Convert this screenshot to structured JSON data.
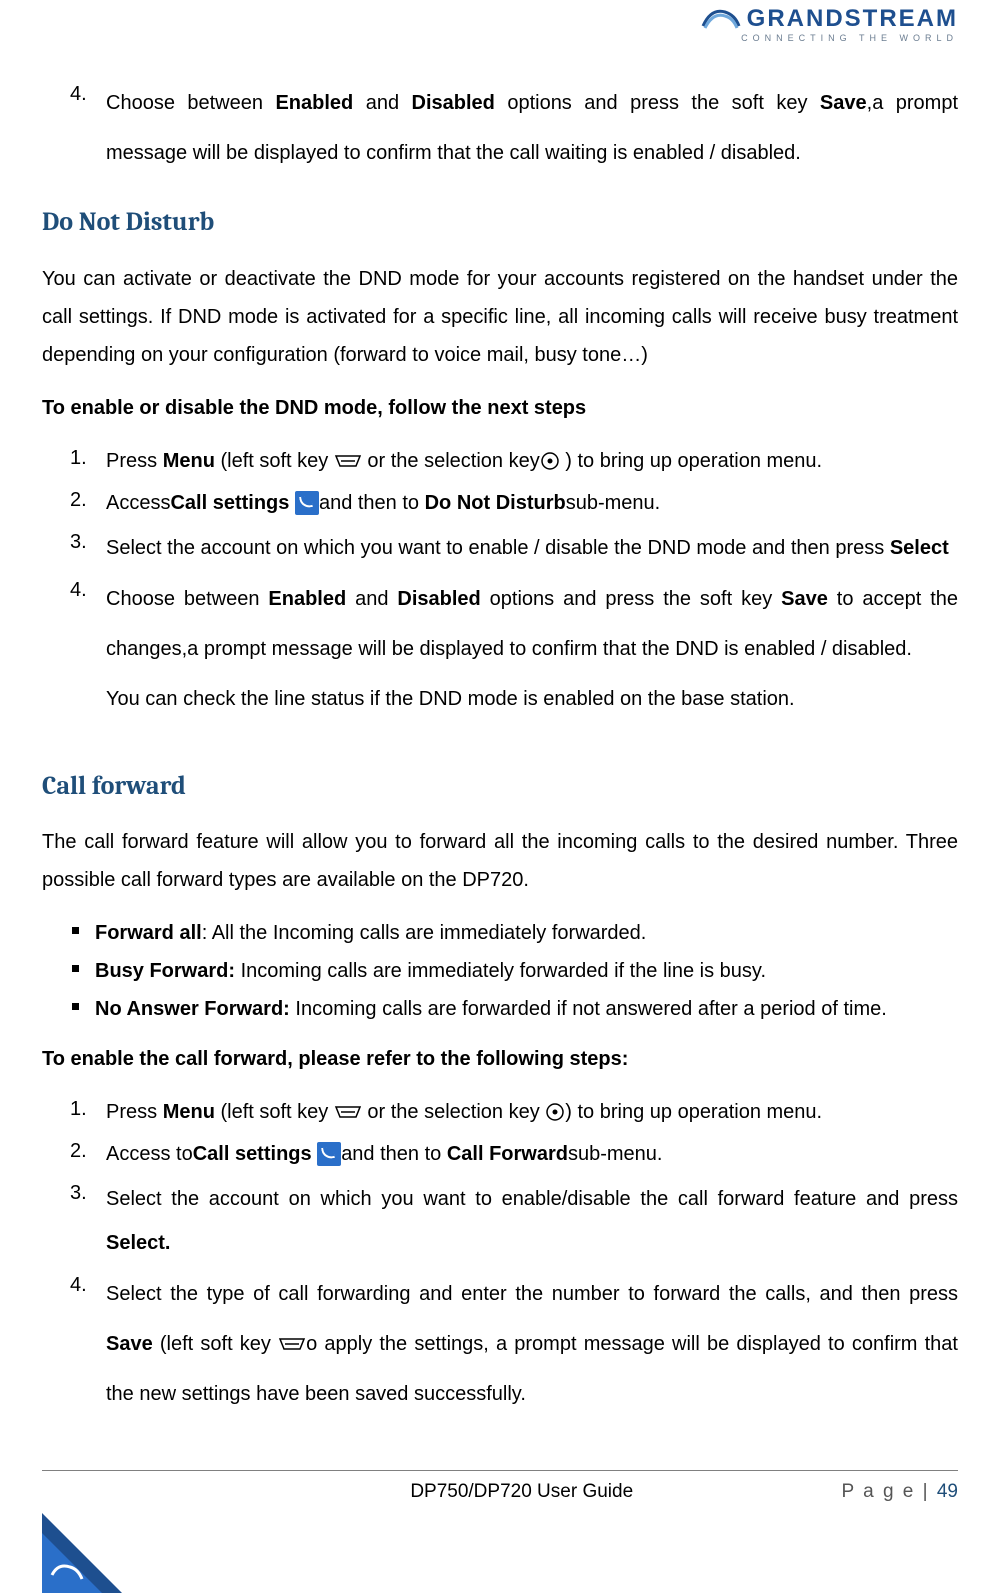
{
  "logo": {
    "name": "GRANDSTREAM",
    "tagline": "CONNECTING THE WORLD"
  },
  "intro_item": {
    "num": "4.",
    "pre": "Choose between ",
    "b1": "Enabled",
    "mid1": " and ",
    "b2": "Disabled",
    "mid2": " options and press the soft key ",
    "b3": "Save",
    "post": ",a prompt message will be displayed to confirm that the call waiting is enabled / disabled."
  },
  "dnd": {
    "title": "Do Not Disturb",
    "para": "You can activate or deactivate the DND mode for your accounts registered on the handset under the call settings. If DND mode is activated for a specific line, all incoming calls will receive busy treatment depending on your configuration (forward to voice mail, busy tone…)",
    "lead": "To enable or disable the DND mode, follow the next steps",
    "s1": {
      "num": "1.",
      "a": "Press ",
      "b1": "Menu",
      "b": " (left soft key ",
      "c": " or the selection key",
      "d": " ) to bring up operation menu."
    },
    "s2": {
      "num": "2.",
      "a": "Access",
      "b1": "Call settings",
      "b": "  ",
      "c": "and then to ",
      "b2": "Do Not Disturb",
      "d": "sub-menu."
    },
    "s3": {
      "num": "3.",
      "a": "Select the account on which you want to enable / disable the DND mode and then press ",
      "b1": "Select"
    },
    "s4": {
      "num": "4.",
      "a": "Choose between ",
      "b1": "Enabled",
      "b": " and ",
      "b2": "Disabled",
      "c": " options and press the soft key ",
      "b3": "Save",
      "d": " to accept the changes,a prompt message will be displayed to confirm that the DND is enabled / disabled."
    },
    "after": "You can check the line status if the DND mode is enabled on the base station."
  },
  "cf": {
    "title": "Call forward",
    "para": "The call forward feature will allow you to forward all the incoming calls to the desired number. Three possible call forward types are available on the DP720.",
    "b1": {
      "t": "Forward all",
      "r": ": All the Incoming calls are immediately forwarded."
    },
    "b2": {
      "t": "Busy Forward:",
      "r": " Incoming calls are immediately forwarded if the line is busy."
    },
    "b3": {
      "t": "No Answer Forward:",
      "r": " Incoming calls are forwarded if not answered after a period of time."
    },
    "lead": "To enable the call forward, please refer to the following steps:",
    "s1": {
      "num": "1.",
      "a": "Press ",
      "b1": "Menu",
      "b": " (left soft key ",
      "c": " or the selection key ",
      "d": ") to bring up operation menu."
    },
    "s2": {
      "num": "2.",
      "a": "Access to",
      "b1": "Call settings",
      "b": "  ",
      "c": "and then to ",
      "b2": "Call Forward",
      "d": "sub-menu."
    },
    "s3": {
      "num": "3.",
      "a": "Select the account on which you want to enable/disable the call forward feature and press ",
      "b1": "Select."
    },
    "s4": {
      "num": "4.",
      "a": "Select the type of call forwarding and enter the number to forward the calls, and then press ",
      "b1": "Save",
      "b": " (left soft key  ",
      "c": "o apply the settings, a prompt message will be displayed to confirm that the new settings have been saved successfully."
    }
  },
  "footer": {
    "center": "DP750/DP720 User Guide",
    "right_label": "P a g e | ",
    "page": "49"
  }
}
